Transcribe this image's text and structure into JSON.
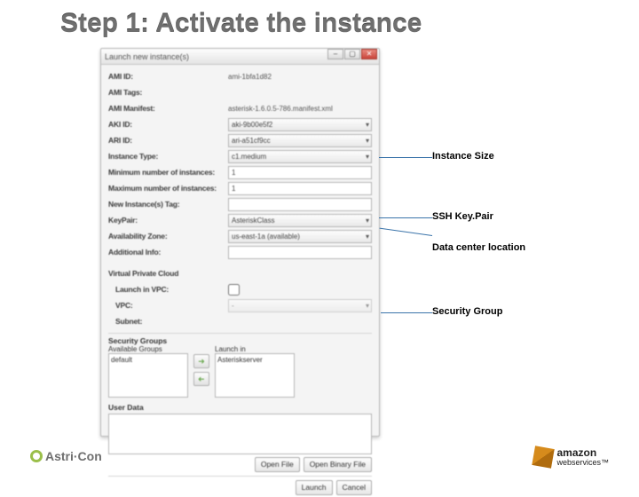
{
  "slide_title": "Step 1: Activate the instance",
  "window": {
    "title": "Launch new instance(s)"
  },
  "fields": {
    "ami_id": {
      "label": "AMI ID:",
      "value": "ami-1bfa1d82"
    },
    "ami_tags": {
      "label": "AMI Tags:"
    },
    "ami_manifest": {
      "label": "AMI Manifest:",
      "value": "asterisk-1.6.0.5-786.manifest.xml"
    },
    "aki_id": {
      "label": "AKI ID:",
      "value": "aki-9b00e5f2"
    },
    "ari_id": {
      "label": "ARI ID:",
      "value": "ari-a51cf9cc"
    },
    "instance_type": {
      "label": "Instance Type:",
      "value": "c1.medium"
    },
    "min_inst": {
      "label": "Minimum number of instances:",
      "value": "1"
    },
    "max_inst": {
      "label": "Maximum number of instances:",
      "value": "1"
    },
    "new_tag": {
      "label": "New Instance(s) Tag:"
    },
    "keypair": {
      "label": "KeyPair:",
      "value": "AsteriskClass"
    },
    "avail_zone": {
      "label": "Availability Zone:",
      "value": "us-east-1a (available)"
    },
    "addl_info": {
      "label": "Additional Info:"
    },
    "vpc_hdr": {
      "label": "Virtual Private Cloud"
    },
    "launch_vpc": {
      "label": "Launch in VPC:"
    },
    "vpc": {
      "label": "VPC:",
      "value": "-"
    },
    "subnet": {
      "label": "Subnet:"
    }
  },
  "sg": {
    "heading": "Security Groups",
    "available_label": "Available Groups",
    "launch_in_label": "Launch in",
    "available": [
      "default"
    ],
    "launch_in": [
      "Asteriskserver"
    ]
  },
  "userdata": {
    "label": "User Data"
  },
  "buttons": {
    "open_file": "Open File",
    "open_binary": "Open Binary File",
    "launch": "Launch",
    "cancel": "Cancel"
  },
  "callouts": {
    "instance_size": "Instance Size",
    "ssh_keypair": "SSH Key.Pair",
    "dc_location": "Data center location",
    "security_group": "Security Group"
  },
  "logos": {
    "astricon": "Astri·Con",
    "aws_brand": "amazon",
    "aws_sub": "webservices™"
  }
}
